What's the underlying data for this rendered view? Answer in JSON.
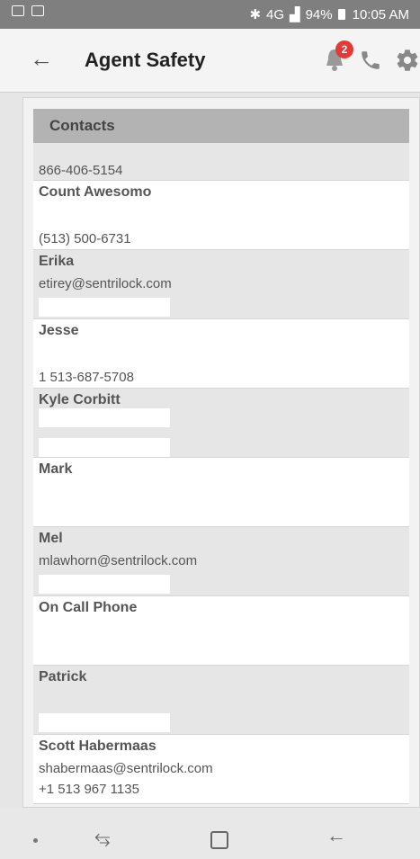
{
  "status_bar": {
    "battery": "94%",
    "time": "10:05 AM",
    "network": "4G"
  },
  "app_bar": {
    "title": "Agent Safety",
    "notification_count": "2"
  },
  "contacts": {
    "header": "Contacts",
    "items": [
      {
        "name": "",
        "email": "",
        "phone": "866-406-5154"
      },
      {
        "name": "Count Awesomo",
        "email": "",
        "phone": "(513) 500-6731"
      },
      {
        "name": "Erika",
        "email": "etirey@sentrilock.com",
        "phone": ""
      },
      {
        "name": "Jesse",
        "email": "",
        "phone": "1 513-687-5708"
      },
      {
        "name": "Kyle Corbitt",
        "email": "",
        "phone": ""
      },
      {
        "name": "Mark",
        "email": "",
        "phone": ""
      },
      {
        "name": "Mel",
        "email": "mlawhorn@sentrilock.com",
        "phone": ""
      },
      {
        "name": "On Call Phone",
        "email": "",
        "phone": ""
      },
      {
        "name": "Patrick",
        "email": "",
        "phone": ""
      },
      {
        "name": "Scott Habermaas",
        "email": "shabermaas@sentrilock.com",
        "phone": "+1 513 967 1135"
      }
    ]
  },
  "navigation": {
    "recent_icon": "recent-apps-icon",
    "home_icon": "home-icon",
    "back_icon": "back-icon"
  }
}
